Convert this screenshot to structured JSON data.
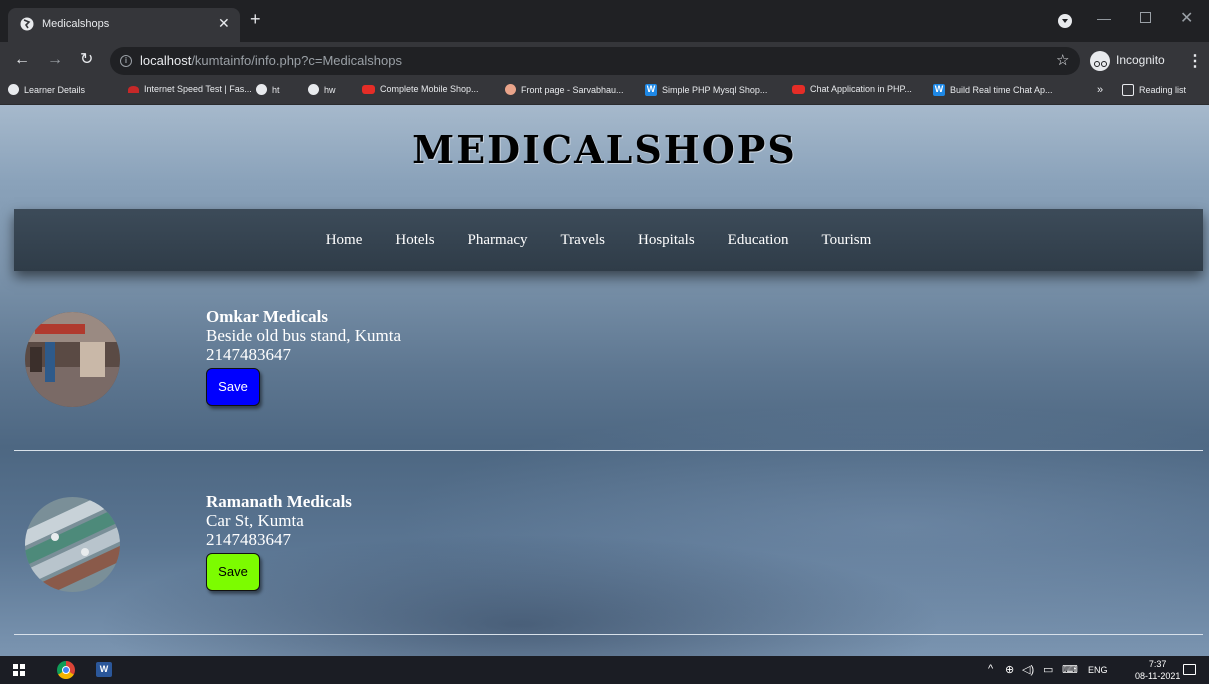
{
  "browser": {
    "tab_title": "Medicalshops",
    "url_host": "localhost",
    "url_path": "/kumtainfo/info.php?c=Medicalshops",
    "profile_label": "Incognito",
    "bookmarks": [
      "Learner Details",
      "Internet Speed Test | Fas...",
      "ht",
      "hw",
      "Complete Mobile Shop...",
      "Front page - Sarvabhau...",
      "Simple PHP Mysql Shop...",
      "Chat Application in PHP...",
      "Build Real time Chat Ap..."
    ],
    "more_bookmarks": "»",
    "reading_list": "Reading list"
  },
  "site": {
    "title": "MEDICALSHOPS",
    "nav": [
      "Home",
      "Hotels",
      "Pharmacy",
      "Travels",
      "Hospitals",
      "Education",
      "Tourism"
    ]
  },
  "shops": [
    {
      "name": "Omkar Medicals",
      "address": "Beside old bus stand, Kumta",
      "phone": "2147483647",
      "save_label": "Save",
      "button_color": "#0000ff",
      "button_text_color": "#ffffff"
    },
    {
      "name": "Ramanath Medicals",
      "address": "Car St, Kumta",
      "phone": "2147483647",
      "save_label": "Save",
      "button_color": "#7cfc00",
      "button_text_color": "#000000"
    }
  ],
  "taskbar": {
    "language": "ENG",
    "time": "7:37",
    "date": "08-11-2021"
  }
}
